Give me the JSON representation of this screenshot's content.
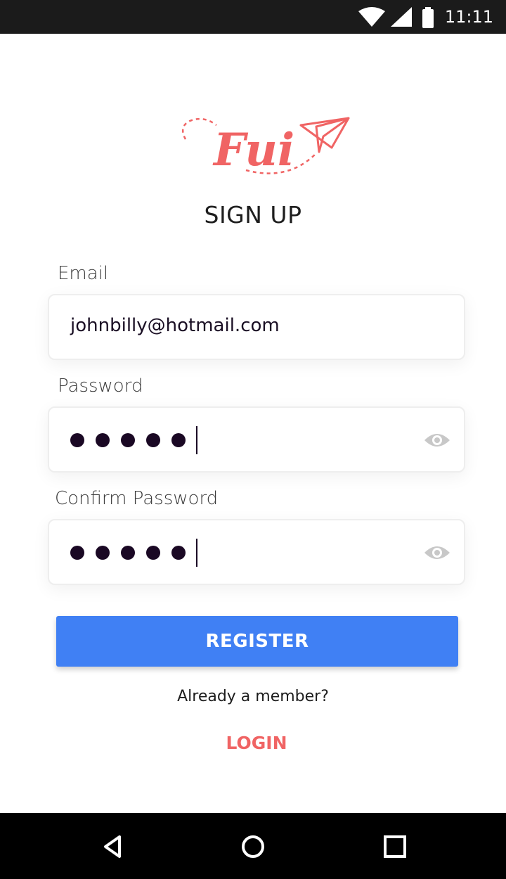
{
  "status_bar": {
    "time": "11:11",
    "icons": [
      "wifi-icon",
      "signal-icon",
      "battery-icon"
    ]
  },
  "logo": {
    "text": "Fui",
    "icon": "paper-plane-icon",
    "color": "#f06464"
  },
  "page": {
    "title": "SIGN UP"
  },
  "form": {
    "email_label": "Email",
    "email_value": "johnbilly@hotmail.com",
    "password_label": "Password",
    "confirm_label": "Confirm Password",
    "password_mask_count": 5,
    "visibility_icon": "eye-icon"
  },
  "register_button": {
    "label": "REGISTER",
    "color": "#4080f4"
  },
  "footer": {
    "prompt": "Already a member?",
    "login_label": "LOGIN",
    "login_color": "#f06464"
  },
  "nav_bar": {
    "icons": [
      "back-icon",
      "home-icon",
      "recents-icon"
    ]
  }
}
